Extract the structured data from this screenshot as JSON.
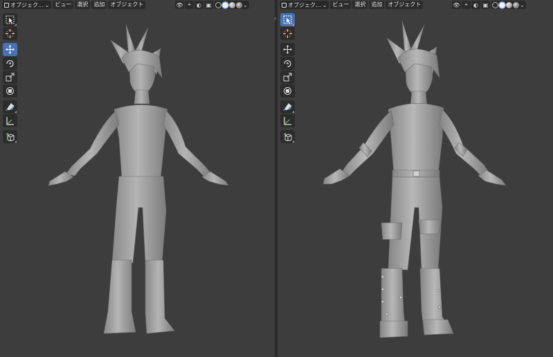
{
  "header": {
    "mode_label": "オブジェク...",
    "menus": [
      "ビュー",
      "選択",
      "追加",
      "オブジェクト"
    ],
    "dropdown_glyph": "⌄"
  },
  "viewports": [
    {
      "id": "left",
      "toolbar_active": "move-tool"
    },
    {
      "id": "right",
      "toolbar_active": "select-box-tool"
    }
  ],
  "toolbar_tools": [
    "select-box-tool",
    "cursor-tool",
    "move-tool",
    "rotate-tool",
    "scale-tool",
    "transform-tool",
    "annotate-tool",
    "measure-tool",
    "add-cube-tool"
  ],
  "shading": {
    "active": "solid"
  },
  "colors": {
    "viewport_bg": "#3d3d3d",
    "header_bg": "#2c2c2c",
    "accent": "#4772b3",
    "model": "#a7a7a7"
  }
}
